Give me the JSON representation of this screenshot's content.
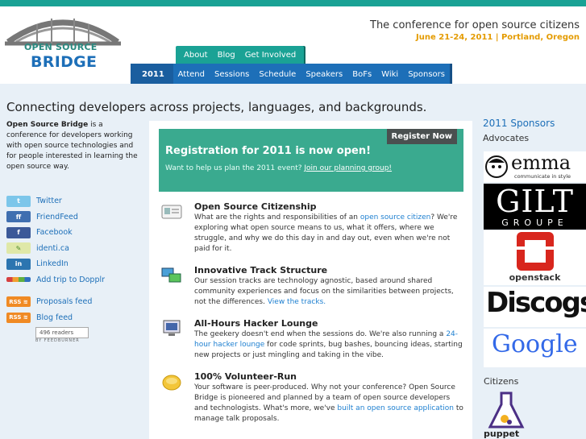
{
  "header": {
    "logo_line1": "OPEN SOURCE",
    "logo_line2": "BRIDGE",
    "tagline": "The conference for open source citizens",
    "dates": "June 21-24, 2011 | Portland, Oregon"
  },
  "subnav": [
    "About",
    "Blog",
    "Get Involved"
  ],
  "mainnav": {
    "year": "2011 ▾",
    "items": [
      "Attend",
      "Sessions",
      "Schedule",
      "Speakers",
      "BoFs",
      "Wiki",
      "Sponsors"
    ]
  },
  "headline": "Connecting developers across projects, languages, and backgrounds.",
  "intro": {
    "name": "Open Source Bridge",
    "text": " is a conference for developers working with open source technologies and for people interested in learning the open source way."
  },
  "social": [
    {
      "label": "Twitter",
      "icon": "twitter-icon",
      "color": "#7cc6ea"
    },
    {
      "label": "FriendFeed",
      "icon": "friendfeed-icon",
      "color": "#3f6fb0"
    },
    {
      "label": "Facebook",
      "icon": "facebook-icon",
      "color": "#3b5998"
    },
    {
      "label": "identi.ca",
      "icon": "identica-icon",
      "color": "#e0e6a0"
    },
    {
      "label": "LinkedIn",
      "icon": "linkedin-icon",
      "color": "#2c75b0"
    },
    {
      "label": "Add trip to Dopplr",
      "icon": "dopplr-icon",
      "color": "#d64040"
    }
  ],
  "feeds": [
    {
      "label": "Proposals feed"
    },
    {
      "label": "Blog feed"
    }
  ],
  "rss_label": "RSS",
  "feedburner": {
    "count": "496 readers",
    "caption": "BY FEEDBURNER"
  },
  "registration": {
    "button": "Register Now",
    "title": "Registration for 2011 is now open!",
    "sub": "Want to help us plan the 2011 event?",
    "link": "Join our planning group!"
  },
  "features": [
    {
      "title": "Open Source Citizenship",
      "pre": "What are the rights and responsibilities of an ",
      "link": "open source citizen",
      "post": "? We're exploring what open source means to us, what it offers, where we struggle, and why we do this day in and day out, even when we're not paid for it."
    },
    {
      "title": "Innovative Track Structure",
      "pre": "Our session tracks are technology agnostic, based around shared community experiences and focus on the similarities between projects, not the differences. ",
      "link": "View the tracks.",
      "post": ""
    },
    {
      "title": "All-Hours Hacker Lounge",
      "pre": "The geekery doesn't end when the sessions do. We're also running a ",
      "link": "24-hour hacker lounge",
      "post": " for code sprints, bug bashes, bouncing ideas, starting new projects or just mingling and taking in the vibe."
    },
    {
      "title": "100% Volunteer-Run",
      "pre": "Your software is peer-produced. Why not your conference? Open Source Bridge is pioneered and planned by a team of open source developers and technologists. What's more, we've ",
      "link": "built an open source application",
      "post": " to manage talk proposals."
    }
  ],
  "sponsors": {
    "title": "2011 Sponsors",
    "advocates": "Advocates",
    "citizens": "Citizens",
    "logos": [
      {
        "name": "emma",
        "tag": "communicate in style"
      },
      {
        "name": "GILT",
        "tag": "GROUPE"
      },
      {
        "name": "openstack",
        "tag": ""
      },
      {
        "name": "Discogs",
        "tag": ""
      },
      {
        "name": "Google",
        "tag": ""
      }
    ],
    "citizen_logo": "puppet"
  }
}
